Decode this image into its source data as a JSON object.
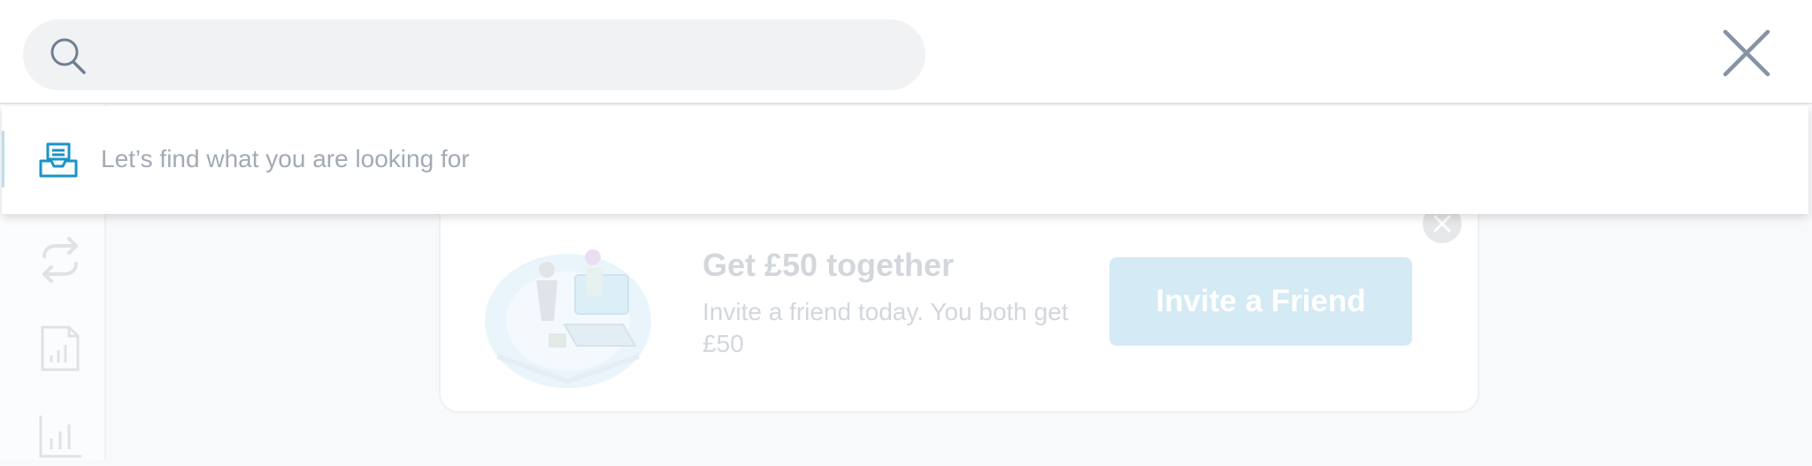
{
  "search": {
    "value": "",
    "placeholder": "",
    "empty_message": "Let’s find what you are looking for"
  },
  "promo": {
    "title": "Get £50 together",
    "subtitle": "Invite a friend today. You both get £50",
    "button_label": "Invite a Friend"
  },
  "icons": {
    "search": "search-icon",
    "close": "close-icon",
    "empty_state": "inbox-tray-icon",
    "rail": [
      "transfer-icon",
      "statement-icon",
      "analytics-icon"
    ]
  },
  "colors": {
    "accent": "#1a93c9",
    "icon_gray": "#6f7f91",
    "button_bg": "#d4eaf4",
    "muted_text": "#a3aab3"
  }
}
